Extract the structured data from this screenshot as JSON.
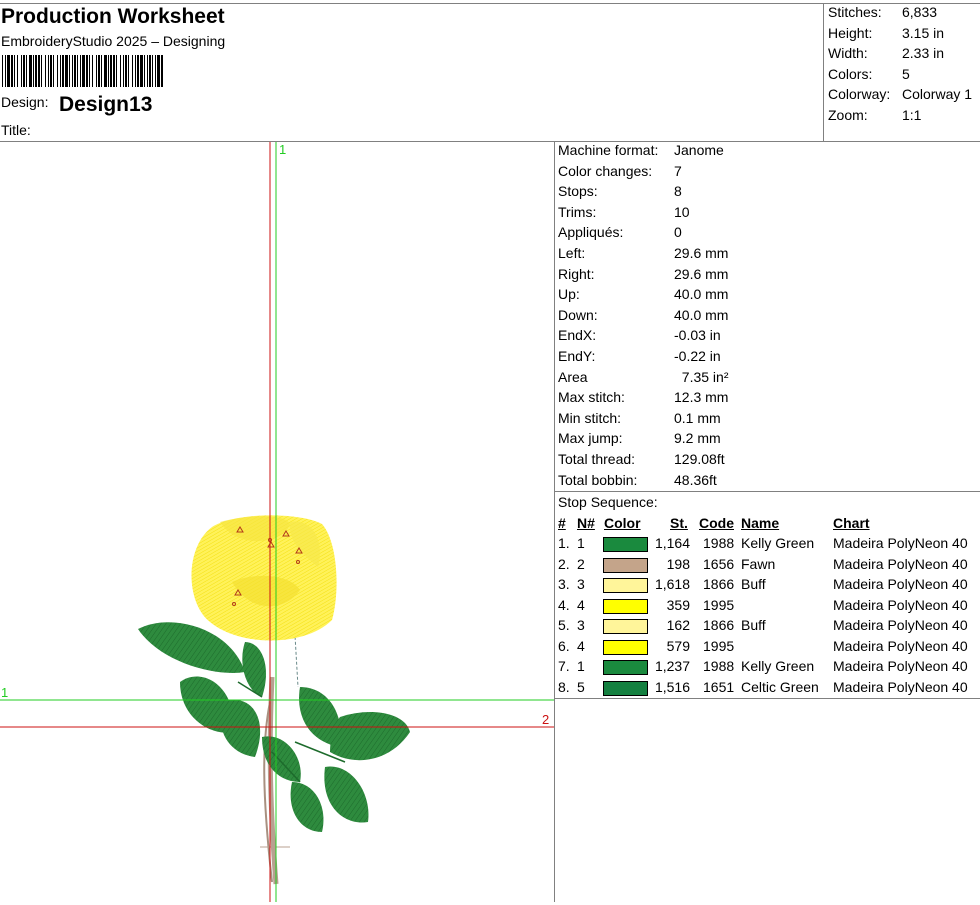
{
  "header": {
    "title": "Production Worksheet",
    "app": "EmbroideryStudio 2025 – Designing",
    "design_label": "Design:",
    "design_name": "Design13",
    "title_label": "Title:"
  },
  "summary": [
    {
      "label": "Stitches:",
      "value": "6,833"
    },
    {
      "label": "Height:",
      "value": "3.15 in"
    },
    {
      "label": "Width:",
      "value": "2.33 in"
    },
    {
      "label": "Colors:",
      "value": "5"
    },
    {
      "label": "Colorway:",
      "value": "Colorway 1"
    },
    {
      "label": "Zoom:",
      "value": "1:1"
    }
  ],
  "details": [
    {
      "label": "Machine format:",
      "value": "Janome"
    },
    {
      "label": "Color changes:",
      "value": "7"
    },
    {
      "label": "Stops:",
      "value": "8"
    },
    {
      "label": "Trims:",
      "value": "10"
    },
    {
      "label": "Appliqués:",
      "value": "0"
    },
    {
      "label": "Left:",
      "value": "29.6 mm"
    },
    {
      "label": "Right:",
      "value": "29.6 mm"
    },
    {
      "label": "Up:",
      "value": "40.0 mm"
    },
    {
      "label": "Down:",
      "value": "40.0 mm"
    },
    {
      "label": "EndX:",
      "value": "-0.03 in"
    },
    {
      "label": "EndY:",
      "value": "-0.22 in"
    },
    {
      "label": "Area",
      "value": "  7.35 in²"
    },
    {
      "label": "Max stitch:",
      "value": "12.3 mm"
    },
    {
      "label": "Min stitch:",
      "value": "0.1 mm"
    },
    {
      "label": "Max jump:",
      "value": "9.2 mm"
    },
    {
      "label": "Total thread:",
      "value": "129.08ft"
    },
    {
      "label": "Total bobbin:",
      "value": "48.36ft"
    }
  ],
  "stop_sequence": {
    "title": "Stop Sequence:",
    "columns": {
      "idx": "#",
      "n": "N#",
      "color": "Color",
      "st": "St.",
      "code": "Code",
      "name": "Name",
      "chart": "Chart"
    },
    "rows": [
      {
        "idx": "1.",
        "n": "1",
        "swatch": "#1a8a3e",
        "st": "1,164",
        "code": "1988",
        "name": "Kelly Green",
        "chart": "Madeira PolyNeon 40"
      },
      {
        "idx": "2.",
        "n": "2",
        "swatch": "#c4a48a",
        "st": "198",
        "code": "1656",
        "name": "Fawn",
        "chart": "Madeira PolyNeon 40"
      },
      {
        "idx": "3.",
        "n": "3",
        "swatch": "#fff59a",
        "st": "1,618",
        "code": "1866",
        "name": "Buff",
        "chart": "Madeira PolyNeon 40"
      },
      {
        "idx": "4.",
        "n": "4",
        "swatch": "#ffff00",
        "st": "359",
        "code": "1995",
        "name": "",
        "chart": "Madeira PolyNeon 40"
      },
      {
        "idx": "5.",
        "n": "3",
        "swatch": "#fff59a",
        "st": "162",
        "code": "1866",
        "name": "Buff",
        "chart": "Madeira PolyNeon 40"
      },
      {
        "idx": "6.",
        "n": "4",
        "swatch": "#ffff00",
        "st": "579",
        "code": "1995",
        "name": "",
        "chart": "Madeira PolyNeon 40"
      },
      {
        "idx": "7.",
        "n": "1",
        "swatch": "#1a8a3e",
        "st": "1,237",
        "code": "1988",
        "name": "Kelly Green",
        "chart": "Madeira PolyNeon 40"
      },
      {
        "idx": "8.",
        "n": "5",
        "swatch": "#148040",
        "st": "1,516",
        "code": "1651",
        "name": "Celtic Green",
        "chart": "Madeira PolyNeon 40"
      }
    ]
  },
  "preview": {
    "marker_top": "1",
    "marker_left": "1",
    "marker_right": "2",
    "colors": {
      "green": "#2e8b3e",
      "yellow": "#ffef3a",
      "stem": "#b8a090",
      "guide_green": "#22cc22",
      "guide_red": "#cc1111"
    }
  }
}
